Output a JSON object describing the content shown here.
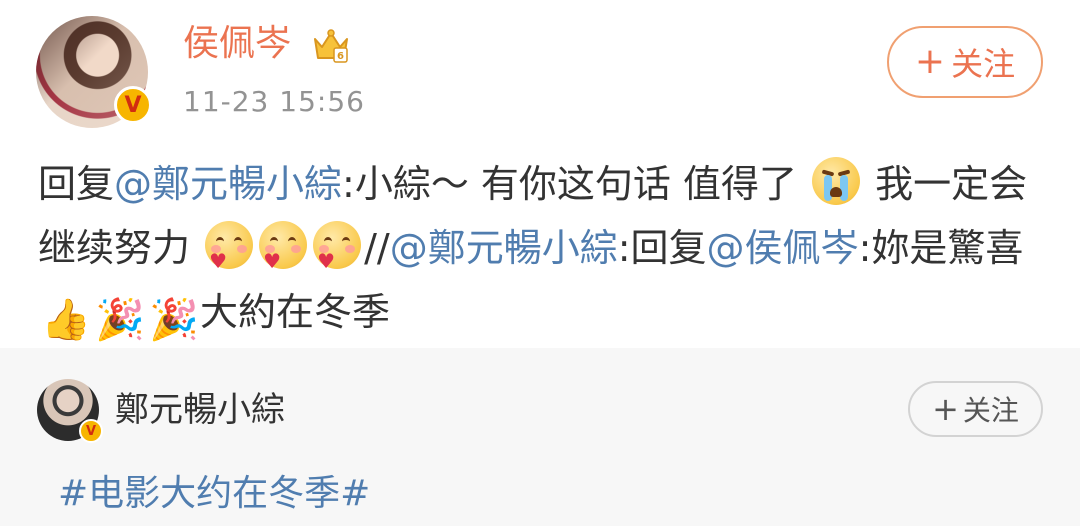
{
  "post": {
    "author": "侯佩岑",
    "time": "11-23 15:56",
    "follow_label": "关注",
    "follow_plus": "+",
    "avatar_badge": "V",
    "content": {
      "p1": "回复",
      "mention1": "@鄭元暢小綜",
      "p2": ":小綜～ 有你这句话 值得了",
      "p3": " 我一定会继续努力",
      "p4": "//",
      "mention2": "@鄭元暢小綜",
      "p5": ":回复",
      "mention3": "@侯佩岑",
      "p6": ":妳是驚喜",
      "p7": "大約在冬季"
    },
    "emoji": {
      "cry": "crying-emoji",
      "love": "love-emoji",
      "thumb": "thumbs-up-emoji",
      "party": "party-popper-emoji"
    }
  },
  "repost": {
    "author": "鄭元暢小綜",
    "follow_label": "关注",
    "follow_plus": "+",
    "avatar_badge": "V",
    "hashtag": "#电影大约在冬季#"
  },
  "colors": {
    "name_orange": "#eb7350",
    "link_blue": "#507daf",
    "badge_gold": "#f7b500",
    "comment_bg": "#f7f7f7"
  }
}
